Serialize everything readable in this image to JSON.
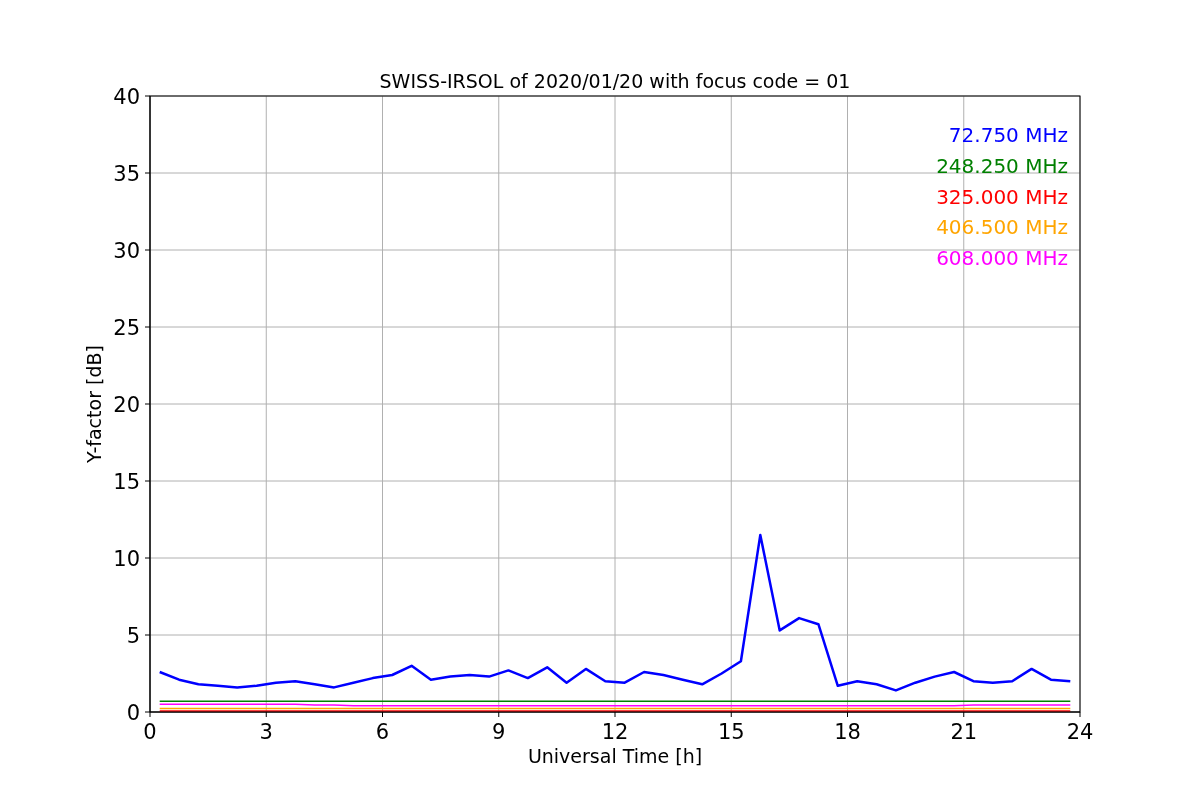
{
  "chart_data": {
    "type": "line",
    "title": "SWISS-IRSOL of 2020/01/20 with focus code = 01",
    "xlabel": "Universal Time [h]",
    "ylabel": "Y-factor [dB]",
    "x": [
      0.25,
      0.75,
      1.25,
      1.75,
      2.25,
      2.75,
      3.25,
      3.75,
      4.25,
      4.75,
      5.25,
      5.75,
      6.25,
      6.75,
      7.25,
      7.75,
      8.25,
      8.75,
      9.25,
      9.75,
      10.25,
      10.75,
      11.25,
      11.75,
      12.25,
      12.75,
      13.25,
      13.75,
      14.25,
      14.75,
      15.25,
      15.75,
      16.25,
      16.75,
      17.25,
      17.75,
      18.25,
      18.75,
      19.25,
      19.75,
      20.25,
      20.75,
      21.25,
      21.75,
      22.25,
      22.75,
      23.25,
      23.75
    ],
    "series": [
      {
        "name": "72.750 MHz",
        "color": "#0000ff",
        "values": [
          2.6,
          2.1,
          1.8,
          1.7,
          1.6,
          1.7,
          1.9,
          2.0,
          1.8,
          1.6,
          1.9,
          2.2,
          2.4,
          3.0,
          2.1,
          2.3,
          2.4,
          2.3,
          2.7,
          2.2,
          2.9,
          1.9,
          2.8,
          2.0,
          1.9,
          2.6,
          2.4,
          2.1,
          1.8,
          2.5,
          3.3,
          11.5,
          5.3,
          6.1,
          5.7,
          1.7,
          2.0,
          1.8,
          1.4,
          1.9,
          2.3,
          2.6,
          2.0,
          1.9,
          2.0,
          2.8,
          2.1,
          2.0
        ]
      },
      {
        "name": "248.250 MHz",
        "color": "#008000",
        "values": [
          0.7,
          0.7,
          0.7,
          0.7,
          0.7,
          0.7,
          0.7,
          0.7,
          0.7,
          0.7,
          0.7,
          0.7,
          0.7,
          0.7,
          0.7,
          0.7,
          0.7,
          0.7,
          0.7,
          0.7,
          0.7,
          0.7,
          0.7,
          0.7,
          0.7,
          0.7,
          0.7,
          0.7,
          0.7,
          0.7,
          0.7,
          0.7,
          0.7,
          0.7,
          0.7,
          0.7,
          0.7,
          0.7,
          0.7,
          0.7,
          0.7,
          0.7,
          0.7,
          0.7,
          0.7,
          0.7,
          0.7,
          0.7
        ]
      },
      {
        "name": "325.000 MHz",
        "color": "#ff0000",
        "values": [
          0.07,
          0.07,
          0.07,
          0.07,
          0.07,
          0.07,
          0.07,
          0.07,
          0.07,
          0.07,
          0.07,
          0.07,
          0.07,
          0.07,
          0.07,
          0.07,
          0.07,
          0.07,
          0.07,
          0.07,
          0.07,
          0.07,
          0.07,
          0.07,
          0.07,
          0.07,
          0.07,
          0.07,
          0.07,
          0.07,
          0.07,
          0.07,
          0.07,
          0.07,
          0.07,
          0.07,
          0.07,
          0.07,
          0.07,
          0.07,
          0.07,
          0.07,
          0.07,
          0.07,
          0.07,
          0.07,
          0.07,
          0.07
        ]
      },
      {
        "name": "406.500 MHz",
        "color": "#ffa500",
        "values": [
          0.22,
          0.22,
          0.22,
          0.22,
          0.22,
          0.22,
          0.22,
          0.22,
          0.22,
          0.22,
          0.22,
          0.22,
          0.22,
          0.22,
          0.22,
          0.22,
          0.22,
          0.22,
          0.22,
          0.22,
          0.22,
          0.22,
          0.22,
          0.22,
          0.22,
          0.22,
          0.22,
          0.22,
          0.22,
          0.22,
          0.22,
          0.22,
          0.22,
          0.22,
          0.22,
          0.22,
          0.22,
          0.22,
          0.22,
          0.22,
          0.22,
          0.22,
          0.22,
          0.22,
          0.22,
          0.22,
          0.22,
          0.22
        ]
      },
      {
        "name": "608.000 MHz",
        "color": "#ff00ff",
        "values": [
          0.5,
          0.5,
          0.5,
          0.5,
          0.5,
          0.5,
          0.5,
          0.5,
          0.45,
          0.45,
          0.4,
          0.4,
          0.4,
          0.4,
          0.4,
          0.4,
          0.4,
          0.4,
          0.4,
          0.4,
          0.4,
          0.4,
          0.4,
          0.4,
          0.4,
          0.4,
          0.4,
          0.4,
          0.4,
          0.4,
          0.4,
          0.4,
          0.4,
          0.4,
          0.4,
          0.4,
          0.4,
          0.4,
          0.4,
          0.4,
          0.4,
          0.4,
          0.45,
          0.45,
          0.45,
          0.45,
          0.45,
          0.45
        ]
      }
    ],
    "grid": true,
    "xlim": [
      0,
      24
    ],
    "ylim": [
      0,
      40
    ],
    "xticks": [
      0,
      3,
      6,
      9,
      12,
      15,
      18,
      21,
      24
    ],
    "yticks": [
      0,
      5,
      10,
      15,
      20,
      25,
      30,
      35,
      40
    ]
  }
}
